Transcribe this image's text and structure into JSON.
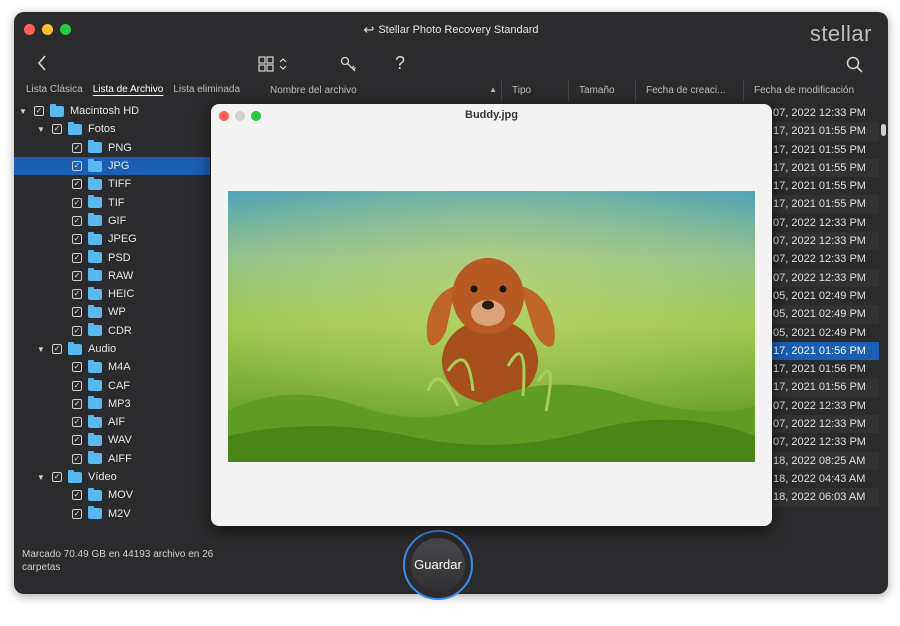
{
  "window": {
    "title": "Stellar Photo Recovery Standard",
    "logo": "stellar"
  },
  "toolbar": {
    "back_icon": "chevron-left-icon",
    "view_icon": "grid-view-icon",
    "key_icon": "key-icon",
    "help_label": "?",
    "search_icon": "search-icon"
  },
  "tabs": [
    "Lista Clásica",
    "Lista de Archivo",
    "Lista eliminada"
  ],
  "columns": [
    "Nombre del archivo",
    "Tipo",
    "Tamaño",
    "Fecha de creaci...",
    "Fecha de modificación"
  ],
  "tree": [
    {
      "label": "Macintosh HD",
      "level": 0,
      "expanded": true
    },
    {
      "label": "Fotos",
      "level": 1,
      "expanded": true
    },
    {
      "label": "PNG",
      "level": 2
    },
    {
      "label": "JPG",
      "level": 2,
      "selected": true
    },
    {
      "label": "TIFF",
      "level": 2
    },
    {
      "label": "TIF",
      "level": 2
    },
    {
      "label": "GIF",
      "level": 2
    },
    {
      "label": "JPEG",
      "level": 2
    },
    {
      "label": "PSD",
      "level": 2
    },
    {
      "label": "RAW",
      "level": 2
    },
    {
      "label": "HEIC",
      "level": 2
    },
    {
      "label": "WP",
      "level": 2
    },
    {
      "label": "CDR",
      "level": 2
    },
    {
      "label": "Audio",
      "level": 1,
      "expanded": true
    },
    {
      "label": "M4A",
      "level": 2
    },
    {
      "label": "CAF",
      "level": 2
    },
    {
      "label": "MP3",
      "level": 2
    },
    {
      "label": "AIF",
      "level": 2
    },
    {
      "label": "WAV",
      "level": 2
    },
    {
      "label": "AIFF",
      "level": 2
    },
    {
      "label": "Vídeo",
      "level": 1,
      "expanded": true
    },
    {
      "label": "MOV",
      "level": 2
    },
    {
      "label": "M2V",
      "level": 2
    }
  ],
  "modified_dates": [
    "07, 2022 12:33 PM",
    "17, 2021 01:55 PM",
    "17, 2021 01:55 PM",
    "17, 2021 01:55 PM",
    "17, 2021 01:55 PM",
    "17, 2021 01:55 PM",
    "07, 2022 12:33 PM",
    "07, 2022 12:33 PM",
    "07, 2022 12:33 PM",
    "07, 2022 12:33 PM",
    "05, 2021 02:49 PM",
    "05, 2021 02:49 PM",
    "05, 2021 02:49 PM",
    "17, 2021 01:56 PM",
    "17, 2021 01:56 PM",
    "17, 2021 01:56 PM",
    "07, 2022 12:33 PM",
    "07, 2022 12:33 PM",
    "07, 2022 12:33 PM",
    "18, 2022 08:25 AM",
    "18, 2022 04:43 AM",
    "18, 2022 06:03 AM"
  ],
  "selected_date_index": 13,
  "status": "Marcado 70.49 GB en 44193 archivo en 26 carpetas",
  "save_button": "Guardar",
  "preview": {
    "title": "Buddy.jpg"
  },
  "colors": {
    "accent": "#1a5fb4",
    "folder": "#5ab8f0",
    "ring": "#3b8be8"
  }
}
